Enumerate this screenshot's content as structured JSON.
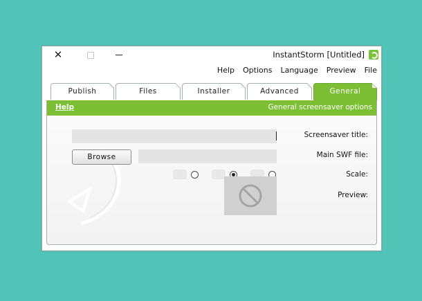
{
  "window": {
    "title": "InstantStorm [Untitled]",
    "controls": {
      "close": "✕"
    }
  },
  "menu": [
    "File",
    "Preview",
    "Language",
    "Options",
    "Help"
  ],
  "tabs": [
    "General",
    "Advanced",
    "Installer",
    "Files",
    "Publish"
  ],
  "active_tab": "General",
  "section": {
    "title": "General screensaver options",
    "help": "Help"
  },
  "fields": {
    "screensaver_title_label": "Screensaver title:",
    "screensaver_title_value": "",
    "main_swf_label": "Main SWF file:",
    "main_swf_value": "",
    "browse_label": "Browse",
    "scale_label": "Scale:",
    "scale_selected_index": 1,
    "preview_label": "Preview:"
  },
  "colors": {
    "accent_green": "#7cbf35",
    "desktop": "#52c4b7"
  },
  "icons": {
    "preview_placeholder": "prohibited-circle-icon",
    "app": "instantstorm-logo-icon"
  }
}
